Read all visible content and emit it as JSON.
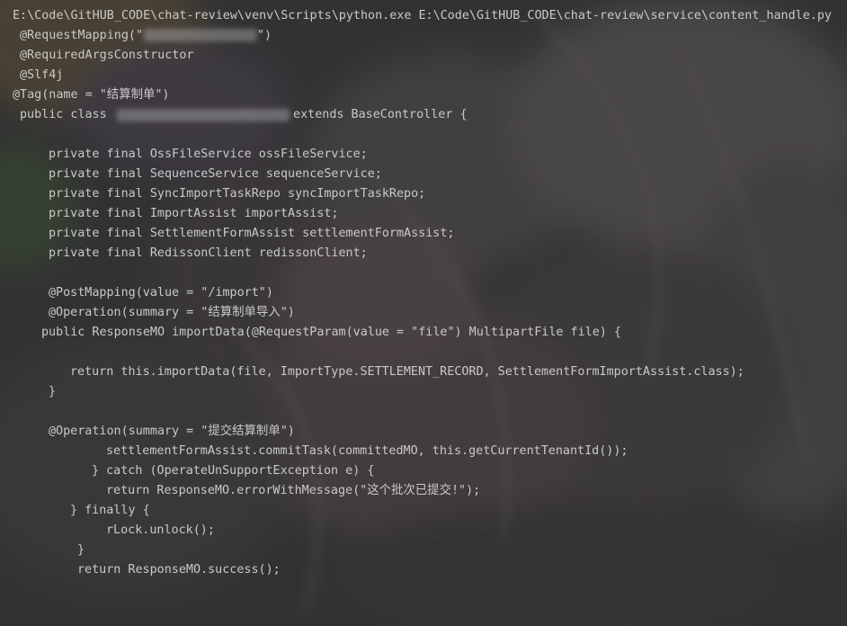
{
  "console": {
    "command_line": "E:\\Code\\GitHUB_CODE\\chat-review\\venv\\Scripts\\python.exe E:\\Code\\GitHUB_CODE\\chat-review\\service\\content_handle.py",
    "lines": [
      "@RequestMapping(\"",
      "\")",
      "@RequiredArgsConstructor",
      "@Slf4j",
      "@Tag(name = \"结算制单\")",
      "public class ",
      " extends BaseController {",
      "private final OssFileService ossFileService;",
      "private final SequenceService sequenceService;",
      "private final SyncImportTaskRepo syncImportTaskRepo;",
      "private final ImportAssist importAssist;",
      "private final SettlementFormAssist settlementFormAssist;",
      "private final RedissonClient redissonClient;",
      "@PostMapping(value = \"/import\")",
      "@Operation(summary = \"结算制单导入\")",
      "public ResponseMO importData(@RequestParam(value = \"file\") MultipartFile file) {",
      "return this.importData(file, ImportType.SETTLEMENT_RECORD, SettlementFormImportAssist.class);",
      "}",
      "@Operation(summary = \"提交结算制单\")",
      "settlementFormAssist.commitTask(committedMO, this.getCurrentTenantId());",
      "} catch (OperateUnSupportException e) {",
      "return ResponseMO.errorWithMessage(\"这个批次已提交!\");",
      "} finally {",
      "rLock.unlock();",
      "}",
      "return ResponseMO.success();"
    ]
  }
}
